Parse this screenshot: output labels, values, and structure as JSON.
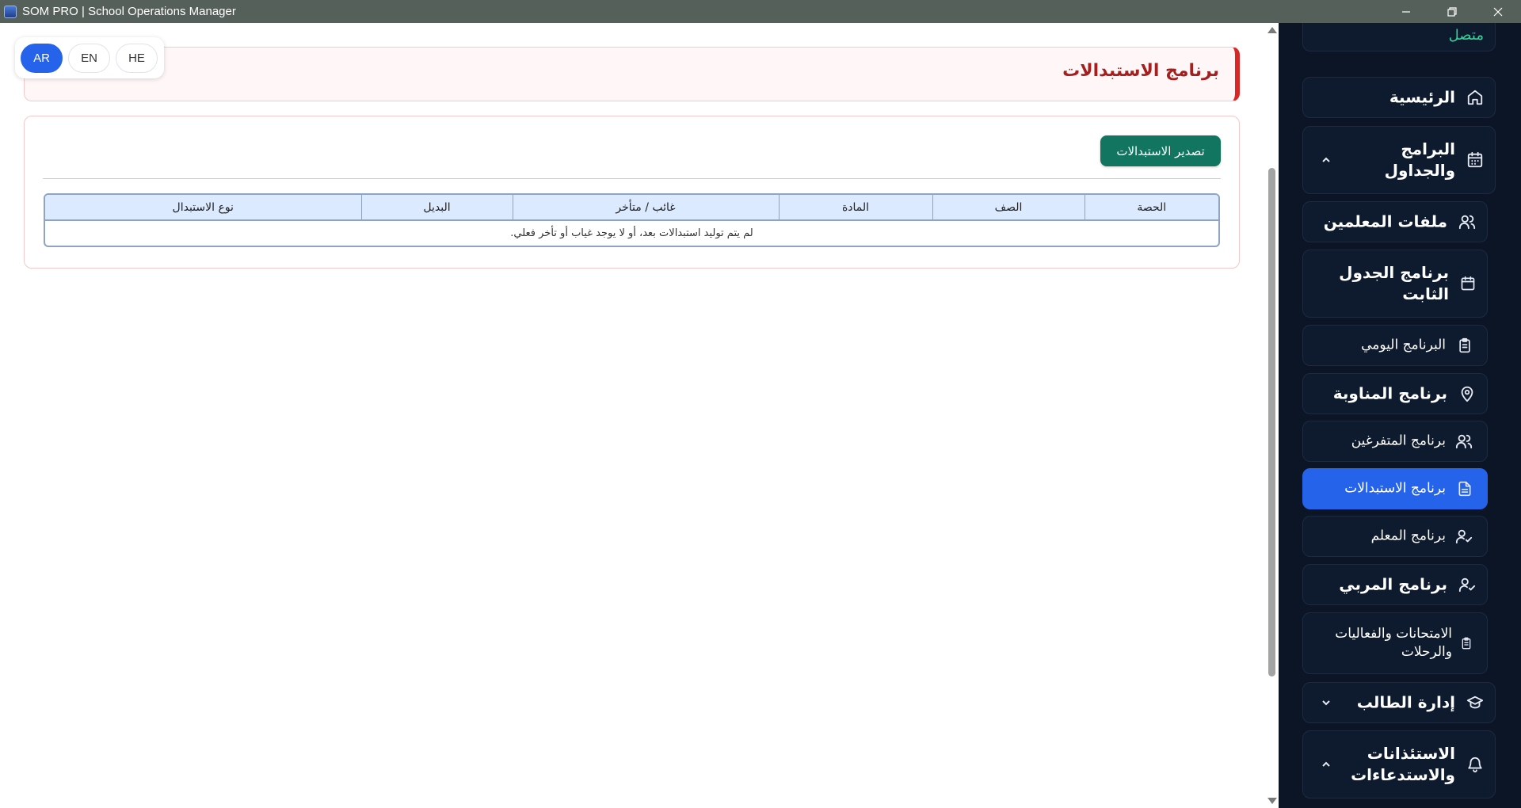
{
  "window": {
    "title": "SOM PRO | School Operations Manager"
  },
  "languages": [
    "AR",
    "EN",
    "HE"
  ],
  "active_language": "AR",
  "page": {
    "title": "برنامج الاستبدالات",
    "export_button": "تصدير الاستبدالات"
  },
  "table": {
    "headers": [
      "الحصة",
      "الصف",
      "المادة",
      "غائب / متأخر",
      "البديل",
      "نوع الاستبدال"
    ],
    "empty_message": "لم يتم توليد استبدالات بعد، أو لا يوجد غياب أو تأخر فعلي."
  },
  "sidebar": {
    "status": "متصل",
    "items": [
      {
        "label": "الرئيسية",
        "icon": "home-icon"
      },
      {
        "label": "البرامج والجداول",
        "icon": "calendar-icon",
        "expanded": true
      },
      {
        "label": "ملفات المعلمين",
        "icon": "users-icon"
      },
      {
        "label": "برنامج الجدول الثابت",
        "icon": "calendar-icon"
      },
      {
        "label": "البرنامج اليومي",
        "icon": "clipboard-icon"
      },
      {
        "label": "برنامج المناوبة",
        "icon": "map-pin-icon"
      },
      {
        "label": "برنامج المتفرغين",
        "icon": "users-icon"
      },
      {
        "label": "برنامج الاستبدالات",
        "icon": "file-text-icon",
        "active": true
      },
      {
        "label": "برنامج المعلم",
        "icon": "user-check-icon"
      },
      {
        "label": "برنامج المربي",
        "icon": "user-check-icon"
      },
      {
        "label": "الامتحانات والفعاليات والرحلات",
        "icon": "clipboard-icon"
      },
      {
        "label": "إدارة الطالب",
        "icon": "graduation-cap-icon",
        "expanded": false
      },
      {
        "label": "الاستئذانات والاستدعاءات",
        "icon": "bell-icon",
        "expanded": true
      }
    ]
  },
  "colors": {
    "sidebar_bg": "#0b1526",
    "active_nav": "#2563eb",
    "title_red": "#a61f1f",
    "accent_red": "#dc2626",
    "export_green": "#11755f",
    "status_green": "#34d399",
    "table_header_bg": "#dbeafe"
  }
}
